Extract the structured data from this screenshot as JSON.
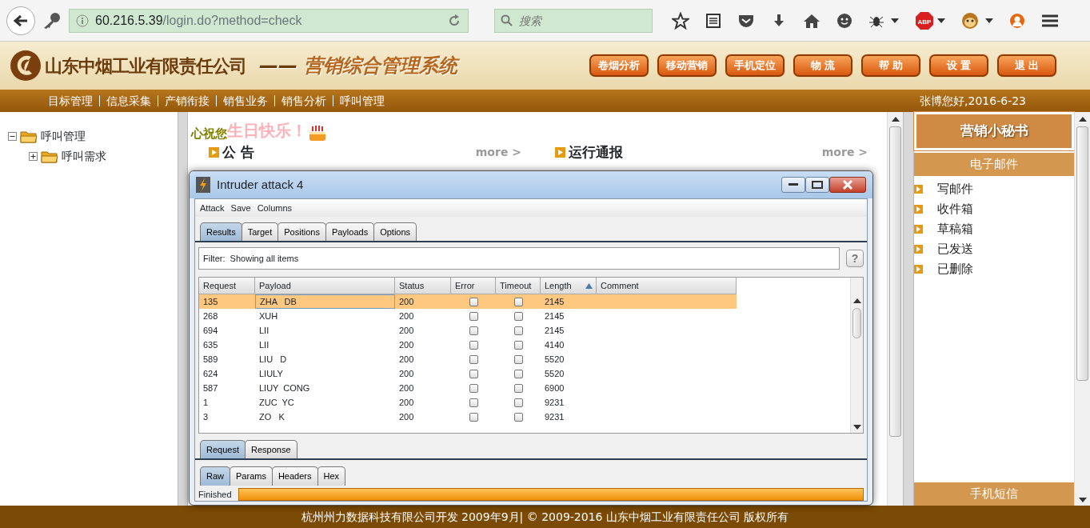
{
  "browser": {
    "url_host": "60.216.5.39",
    "url_path": "/login.do?method=check",
    "search_placeholder": "搜索",
    "adblock_label": "ABP"
  },
  "header": {
    "company": "山东中烟工业有限责任公司",
    "separator": "——",
    "system": "营销综合管理系统",
    "buttons": [
      "卷烟分析",
      "移动营销",
      "手机定位",
      "物 流",
      "帮 助",
      "设 置",
      "退 出"
    ]
  },
  "nav": {
    "items": [
      "目标管理",
      "信息采集",
      "产销衔接",
      "销售业务",
      "销售分析",
      "呼叫管理"
    ],
    "greeting": "张博您好,2016-6-23"
  },
  "tree": [
    {
      "label": "呼叫管理",
      "expanded": true,
      "children": [
        {
          "label": "呼叫需求",
          "expanded": false
        }
      ]
    }
  ],
  "wish": {
    "prefix": "心祝您",
    "text": "生日快乐！"
  },
  "sections": [
    {
      "title": "公 告",
      "more": "more >"
    },
    {
      "title": "运行通报",
      "more": "more >"
    }
  ],
  "dialog": {
    "title": "Intruder attack 4",
    "menu": [
      "Attack",
      "Save",
      "Columns"
    ],
    "tabs": [
      {
        "label": "Results",
        "selected": true
      },
      {
        "label": "Target",
        "selected": false
      },
      {
        "label": "Positions",
        "selected": false
      },
      {
        "label": "Payloads",
        "selected": false
      },
      {
        "label": "Options",
        "selected": false
      }
    ],
    "filter": "Filter:  Showing all items",
    "help": "?",
    "columns": [
      {
        "label": "Request",
        "sorted": false
      },
      {
        "label": "Payload",
        "sorted": false
      },
      {
        "label": "Status",
        "sorted": false
      },
      {
        "label": "Error",
        "sorted": false
      },
      {
        "label": "Timeout",
        "sorted": false
      },
      {
        "label": "Length",
        "sorted": true
      },
      {
        "label": "Comment",
        "sorted": false
      }
    ],
    "rows": [
      {
        "request": "135",
        "payload": "ZHA   DB",
        "status": "200",
        "error": false,
        "timeout": false,
        "length": "2145",
        "selected": true
      },
      {
        "request": "268",
        "payload": "XUH",
        "status": "200",
        "error": false,
        "timeout": false,
        "length": "2145",
        "selected": false
      },
      {
        "request": "694",
        "payload": "LII",
        "status": "200",
        "error": false,
        "timeout": false,
        "length": "2145",
        "selected": false
      },
      {
        "request": "635",
        "payload": "LII",
        "status": "200",
        "error": false,
        "timeout": false,
        "length": "4140",
        "selected": false
      },
      {
        "request": "589",
        "payload": "LIU   D",
        "status": "200",
        "error": false,
        "timeout": false,
        "length": "5520",
        "selected": false
      },
      {
        "request": "624",
        "payload": "LIULY",
        "status": "200",
        "error": false,
        "timeout": false,
        "length": "5520",
        "selected": false
      },
      {
        "request": "587",
        "payload": "LIUY  CONG",
        "status": "200",
        "error": false,
        "timeout": false,
        "length": "6900",
        "selected": false
      },
      {
        "request": "1",
        "payload": "ZUC  YC",
        "status": "200",
        "error": false,
        "timeout": false,
        "length": "9231",
        "selected": false
      },
      {
        "request": "3",
        "payload": "ZO   K",
        "status": "200",
        "error": false,
        "timeout": false,
        "length": "9231",
        "selected": false
      }
    ],
    "lower_tabs": [
      {
        "label": "Request",
        "selected": true
      },
      {
        "label": "Response",
        "selected": false
      }
    ],
    "sub_tabs": [
      {
        "label": "Raw",
        "selected": true
      },
      {
        "label": "Params",
        "selected": false
      },
      {
        "label": "Headers",
        "selected": false
      },
      {
        "label": "Hex",
        "selected": false
      }
    ],
    "status": "Finished",
    "progress": {
      "level": 1
    }
  },
  "sidebar": {
    "title": "营销小秘书",
    "groups": [
      {
        "title": "电子邮件",
        "items": [
          "写邮件",
          "收件箱",
          "草稿箱",
          "已发送",
          "已删除"
        ]
      },
      {
        "title": "手机短信"
      }
    ]
  },
  "footer": "杭州州力数据科技有限公司开发 2009年9月| © 2009-2016 山东中烟工业有限责任公司 版权所有"
}
